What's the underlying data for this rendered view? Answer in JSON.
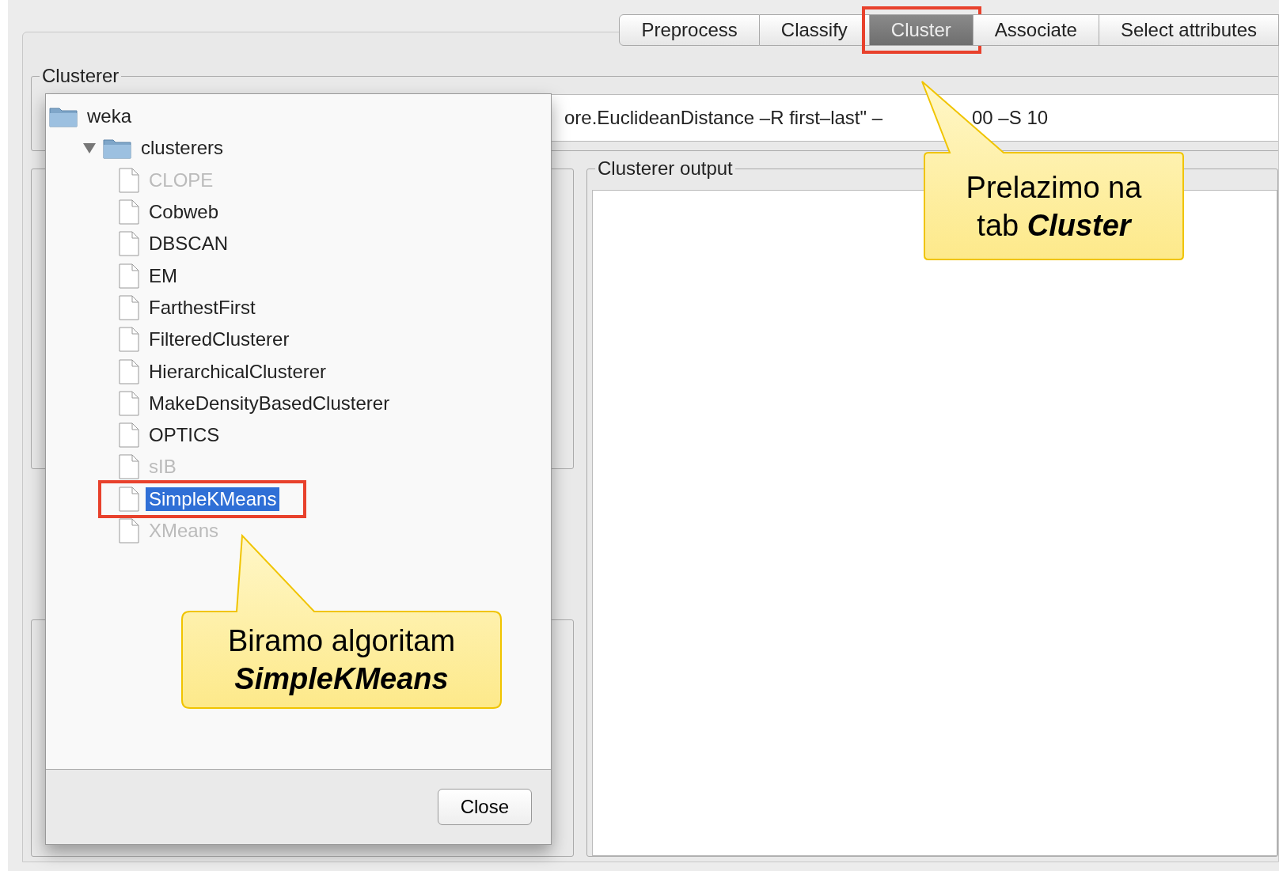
{
  "tabs": [
    {
      "label": "Preprocess",
      "selected": false,
      "highlight_box": false
    },
    {
      "label": "Classify",
      "selected": false,
      "highlight_box": false
    },
    {
      "label": "Cluster",
      "selected": true,
      "highlight_box": true
    },
    {
      "label": "Associate",
      "selected": false,
      "highlight_box": false
    },
    {
      "label": "Select attributes",
      "selected": false,
      "highlight_box": false
    }
  ],
  "clusterer": {
    "title": "Clusterer",
    "value_parts": [
      "ore.EuclideanDistance –R first–last\" –",
      "00 –S 10"
    ]
  },
  "output": {
    "title": "Clusterer output"
  },
  "dialog": {
    "tree": [
      {
        "label": "weka",
        "kind": "folder",
        "children": [
          {
            "label": "clusterers",
            "kind": "folder",
            "expanded": true,
            "children": [
              {
                "label": "CLOPE",
                "kind": "leaf",
                "disabled": true,
                "selected": false,
                "highlight_box": false
              },
              {
                "label": "Cobweb",
                "kind": "leaf",
                "disabled": false,
                "selected": false,
                "highlight_box": false
              },
              {
                "label": "DBSCAN",
                "kind": "leaf",
                "disabled": false,
                "selected": false,
                "highlight_box": false
              },
              {
                "label": "EM",
                "kind": "leaf",
                "disabled": false,
                "selected": false,
                "highlight_box": false
              },
              {
                "label": "FarthestFirst",
                "kind": "leaf",
                "disabled": false,
                "selected": false,
                "highlight_box": false
              },
              {
                "label": "FilteredClusterer",
                "kind": "leaf",
                "disabled": false,
                "selected": false,
                "highlight_box": false
              },
              {
                "label": "HierarchicalClusterer",
                "kind": "leaf",
                "disabled": false,
                "selected": false,
                "highlight_box": false
              },
              {
                "label": "MakeDensityBasedClusterer",
                "kind": "leaf",
                "disabled": false,
                "selected": false,
                "highlight_box": false
              },
              {
                "label": "OPTICS",
                "kind": "leaf",
                "disabled": false,
                "selected": false,
                "highlight_box": false
              },
              {
                "label": "sIB",
                "kind": "leaf",
                "disabled": true,
                "selected": false,
                "highlight_box": false
              },
              {
                "label": "SimpleKMeans",
                "kind": "leaf",
                "disabled": false,
                "selected": true,
                "highlight_box": true
              },
              {
                "label": "XMeans",
                "kind": "leaf",
                "disabled": true,
                "selected": false,
                "highlight_box": false
              }
            ]
          }
        ]
      }
    ],
    "close_button": "Close"
  },
  "callouts": [
    {
      "lines": [
        "Prelazimo na",
        "tab **Cluster**"
      ]
    },
    {
      "lines": [
        "Biramo algoritam",
        "**SimpleKMeans**"
      ]
    }
  ]
}
